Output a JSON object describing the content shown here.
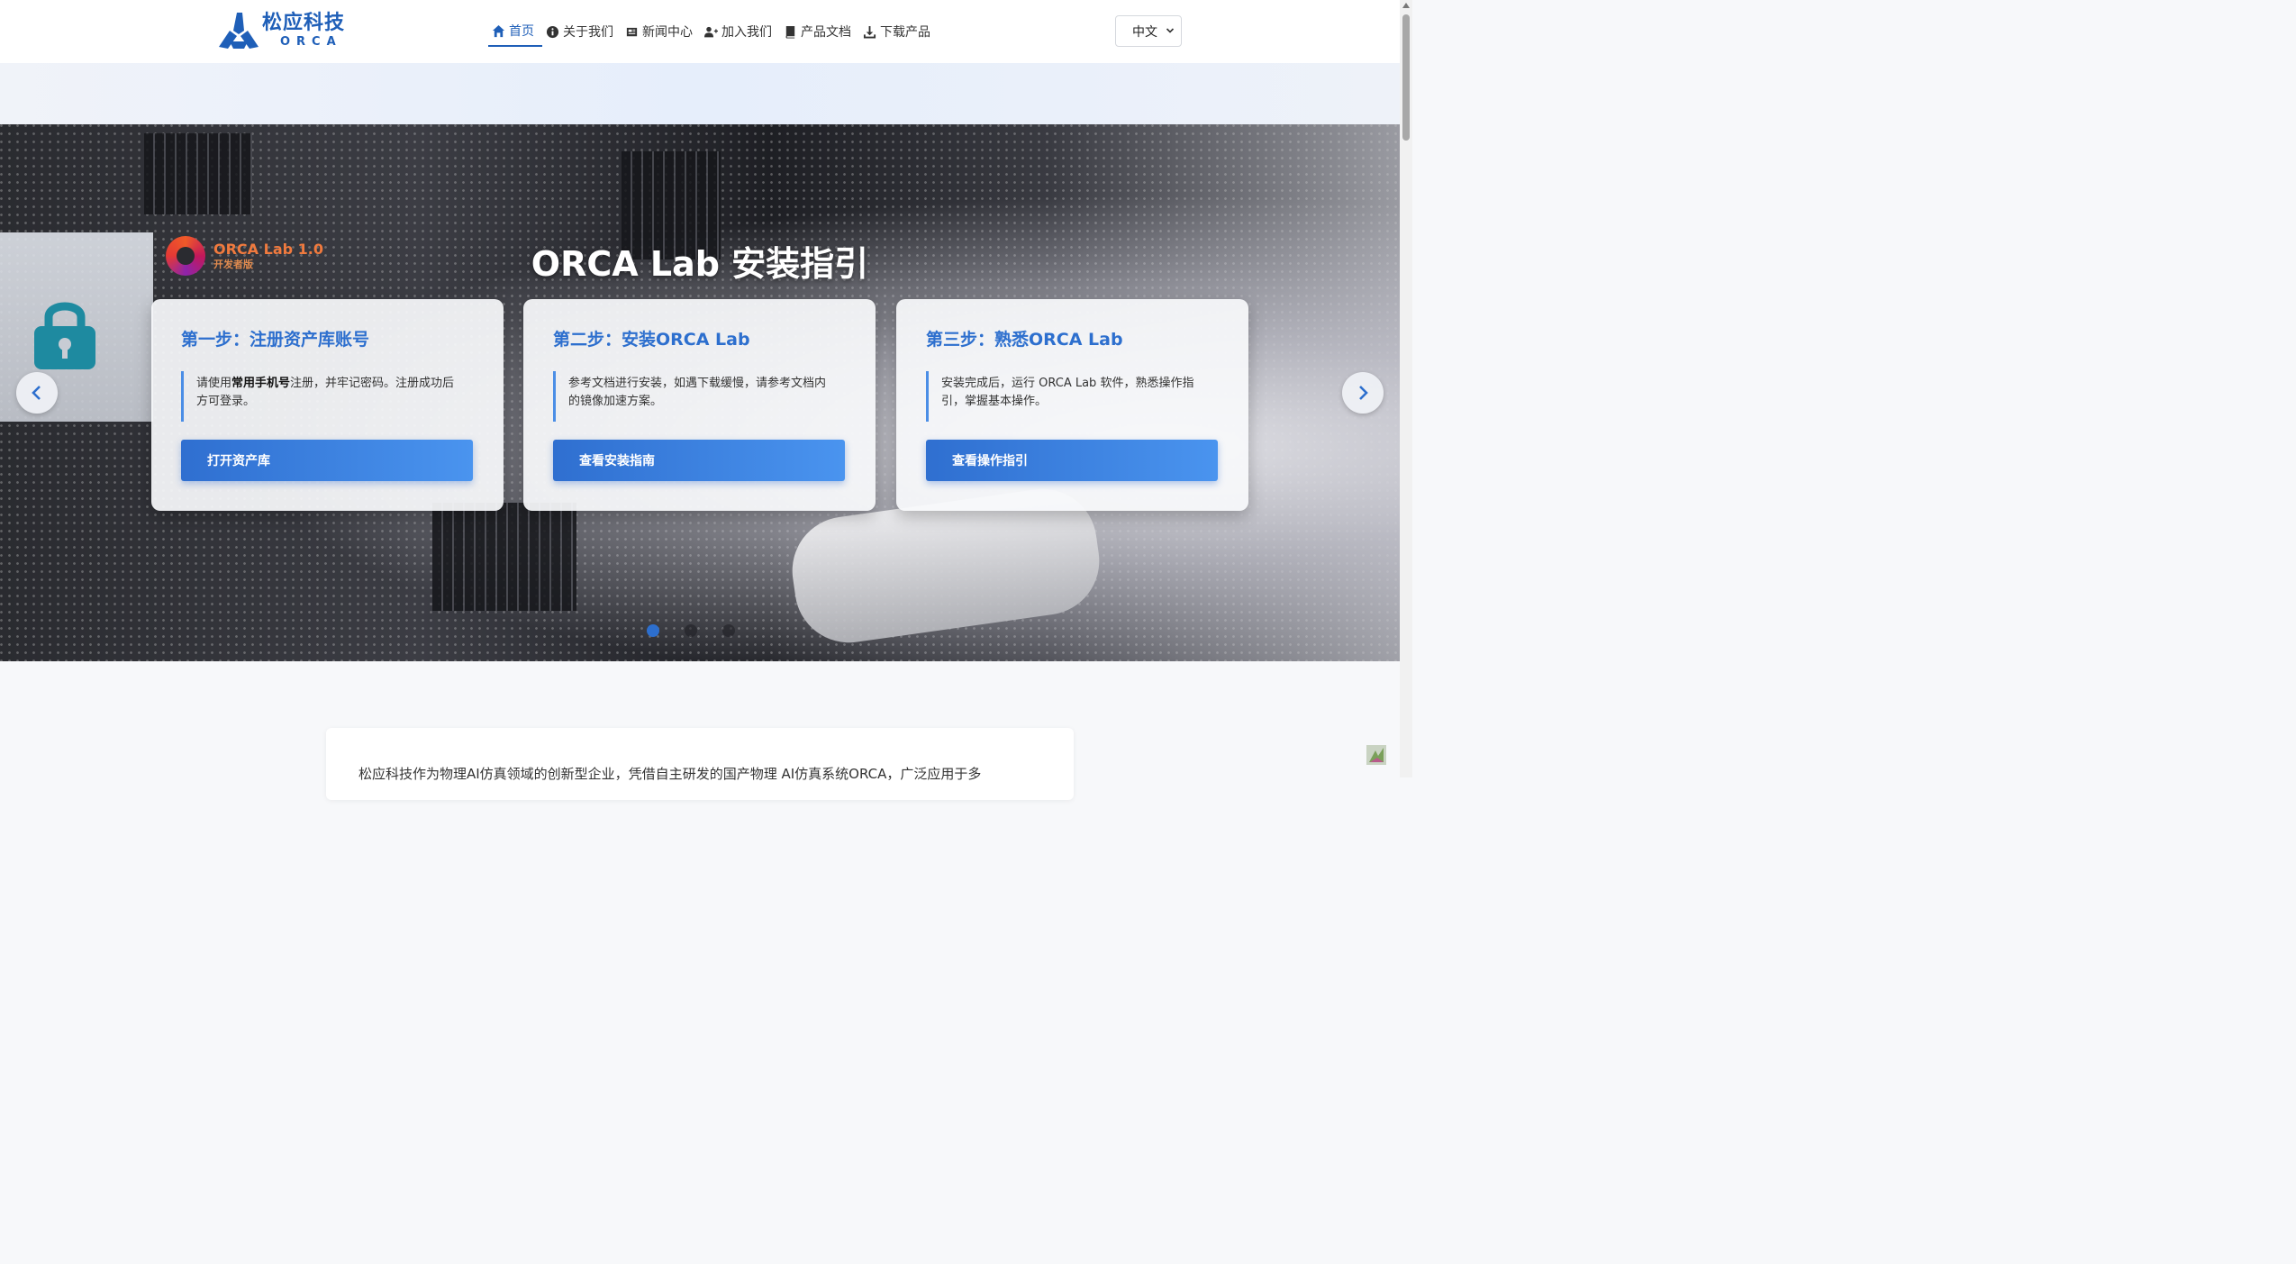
{
  "header": {
    "logo_cn": "松应科技",
    "logo_en": "ORCA",
    "nav": [
      {
        "label": "首页",
        "icon": "home-icon",
        "active": true
      },
      {
        "label": "关于我们",
        "icon": "info-icon",
        "active": false
      },
      {
        "label": "新闻中心",
        "icon": "newspaper-icon",
        "active": false
      },
      {
        "label": "加入我们",
        "icon": "user-plus-icon",
        "active": false
      },
      {
        "label": "产品文档",
        "icon": "book-icon",
        "active": false
      },
      {
        "label": "下载产品",
        "icon": "download-icon",
        "active": false
      }
    ],
    "language": "中文"
  },
  "hero": {
    "title": "ORCA Lab 安装指引",
    "badge_title": "ORCA Lab 1.0",
    "badge_sub": "开发者版",
    "steps": [
      {
        "title": "第一步：注册资产库账号",
        "desc_pre": "请使用",
        "desc_bold": "常用手机号",
        "desc_post": "注册，并牢记密码。注册成功后方可登录。",
        "button": "打开资产库"
      },
      {
        "title": "第二步：安装ORCA Lab",
        "desc_pre": "参考文档进行安装，如遇下载缓慢，请参考文档内的镜像加速方案。",
        "desc_bold": "",
        "desc_post": "",
        "button": "查看安装指南"
      },
      {
        "title": "第三步：熟悉ORCA Lab",
        "desc_pre": "安装完成后，运行 ORCA Lab 软件，熟悉操作指引，掌握基本操作。",
        "desc_bold": "",
        "desc_post": "",
        "button": "查看操作指引"
      }
    ],
    "slide_count": 3,
    "active_slide": 0
  },
  "intro": {
    "text": "松应科技作为物理AI仿真领域的创新型企业，凭借自主研发的国产物理 AI仿真系统ORCA，广泛应用于多"
  },
  "colors": {
    "brand": "#1f5fb8",
    "accent": "#2d6fce",
    "button_gradient_end": "#4a94ef"
  }
}
